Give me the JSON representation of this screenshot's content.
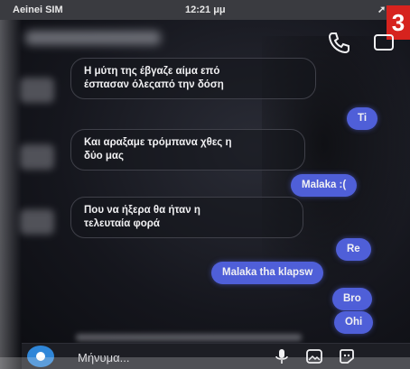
{
  "status_bar": {
    "carrier": "Aeinei SIM",
    "time": "12:21 μμ",
    "arrow": "➚"
  },
  "overlay": {
    "page_number": "3"
  },
  "header": {
    "contact_name": ""
  },
  "messages": {
    "m1": "Η μύτη της έβγαζε αίμα επό\nέσπασαν όλεςαπό την δόση",
    "m2": "Ti",
    "m3": "Και αραξαμε τρόμπανα χθες η\nδύο μας",
    "m4": "Malaka :(",
    "m5": "Που να ήξερα θα ήταν η\nτελευταία φορά",
    "m6": "Re",
    "m7": "Malaka tha klapsw",
    "m8": "Bro",
    "m9": "Ohi"
  },
  "composer": {
    "placeholder": "Μήνυμα..."
  },
  "colors": {
    "outgoing_bubble": "#4f5fd8",
    "camera_button": "#2f86d8",
    "page_badge": "#d6231e"
  },
  "icons": {
    "call": "phone-icon",
    "video": "video-camera-icon",
    "camera": "camera-icon",
    "mic": "microphone-icon",
    "gallery": "gallery-icon",
    "sticker": "sticker-icon"
  }
}
